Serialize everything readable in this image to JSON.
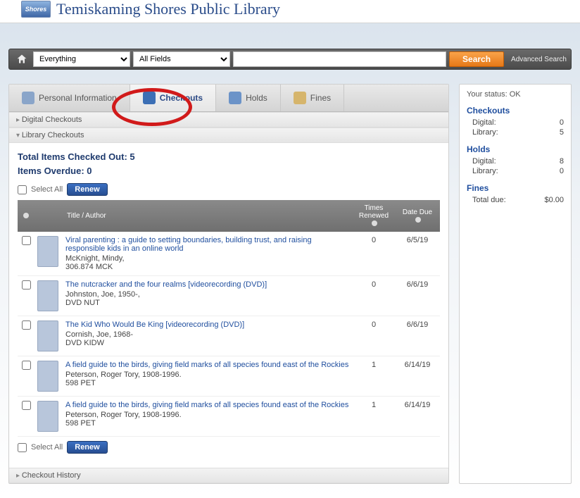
{
  "brand": {
    "logo_text": "Shores",
    "site_name": "Temiskaming Shores Public Library"
  },
  "search": {
    "scope_options": [
      "Everything"
    ],
    "scope_selected": "Everything",
    "field_options": [
      "All Fields"
    ],
    "field_selected": "All Fields",
    "query": "",
    "search_label": "Search",
    "advanced_label": "Advanced Search"
  },
  "tabs": {
    "personal": "Personal Information",
    "checkouts": "Checkouts",
    "holds": "Holds",
    "fines": "Fines"
  },
  "sections": {
    "digital_checkouts": "Digital Checkouts",
    "library_checkouts": "Library Checkouts",
    "checkout_history": "Checkout History"
  },
  "totals": {
    "total_out_label": "Total Items Checked Out:",
    "total_out_value": "5",
    "overdue_label": "Items Overdue:",
    "overdue_value": "0"
  },
  "list_controls": {
    "select_all_label": "Select All",
    "renew_label": "Renew"
  },
  "columns": {
    "title_author": "Title / Author",
    "times_renewed": "Times Renewed",
    "date_due": "Date Due"
  },
  "items": [
    {
      "title": "Viral parenting : a guide to setting boundaries, building trust, and raising responsible kids in an online world",
      "author": "McKnight, Mindy,",
      "callno": "306.874 MCK",
      "renewed": "0",
      "due": "6/5/19"
    },
    {
      "title": "The nutcracker and the four realms [videorecording (DVD)]",
      "author": "Johnston, Joe, 1950-,",
      "callno": "DVD NUT",
      "renewed": "0",
      "due": "6/6/19"
    },
    {
      "title": "The Kid Who Would Be King [videorecording (DVD)]",
      "author": "Cornish, Joe, 1968-",
      "callno": "DVD KIDW",
      "renewed": "0",
      "due": "6/6/19"
    },
    {
      "title": "A field guide to the birds, giving field marks of all species found east of the Rockies",
      "author": "Peterson, Roger Tory, 1908-1996.",
      "callno": "598 PET",
      "renewed": "1",
      "due": "6/14/19"
    },
    {
      "title": "A field guide to the birds, giving field marks of all species found east of the Rockies",
      "author": "Peterson, Roger Tory, 1908-1996.",
      "callno": "598 PET",
      "renewed": "1",
      "due": "6/14/19"
    }
  ],
  "sidebar": {
    "status_label": "Your status:",
    "status_value": "OK",
    "checkouts_heading": "Checkouts",
    "checkouts_digital_label": "Digital:",
    "checkouts_digital_value": "0",
    "checkouts_library_label": "Library:",
    "checkouts_library_value": "5",
    "holds_heading": "Holds",
    "holds_digital_label": "Digital:",
    "holds_digital_value": "8",
    "holds_library_label": "Library:",
    "holds_library_value": "0",
    "fines_heading": "Fines",
    "fines_total_label": "Total due:",
    "fines_total_value": "$0.00"
  }
}
